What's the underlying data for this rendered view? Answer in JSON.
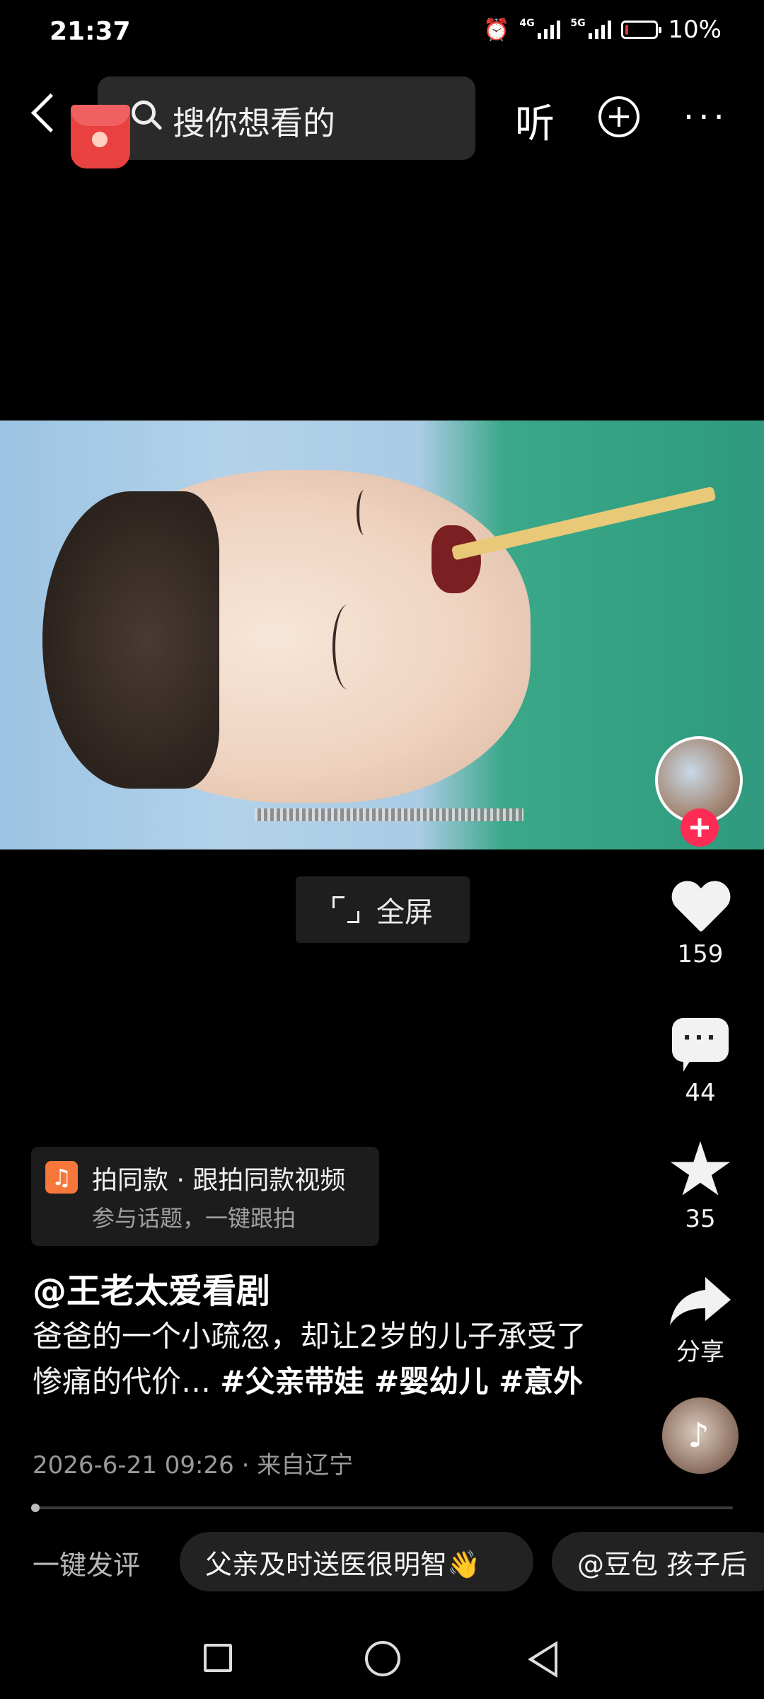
{
  "status": {
    "time": "21:37",
    "signal1_label": "4G",
    "signal2_label": "5G",
    "battery_percent": 10,
    "battery_text": "10%",
    "icons": [
      "alarm-icon",
      "signal-4g-icon",
      "signal-5g-icon",
      "battery-icon"
    ]
  },
  "header": {
    "search_placeholder": "搜你想看的",
    "listen_label": "听"
  },
  "video": {
    "fullscreen_label": "全屏"
  },
  "rail": {
    "likes": "159",
    "comments": "44",
    "favorites": "35",
    "share_label": "分享"
  },
  "template": {
    "title": "拍同款 · 跟拍同款视频",
    "subtitle": "参与话题，一键跟拍",
    "icon_glyph": "♫"
  },
  "post": {
    "author": "@王老太爱看剧",
    "text": "爸爸的一个小疏忽，却让2岁的儿子承受了惨痛的代价… ",
    "tags": "#父亲带娃 #婴幼儿 #意外",
    "timestamp": "2026-6-21 09:26",
    "location": "来自辽宁",
    "separator": "·"
  },
  "comment_bar": {
    "label": "一键发评",
    "chips": [
      "父亲及时送医很明智👋",
      "@豆包 孩子后"
    ]
  },
  "colors": {
    "accent_red": "#fe2c55",
    "template_orange": "#f7773a",
    "battery_low": "#e53935"
  }
}
